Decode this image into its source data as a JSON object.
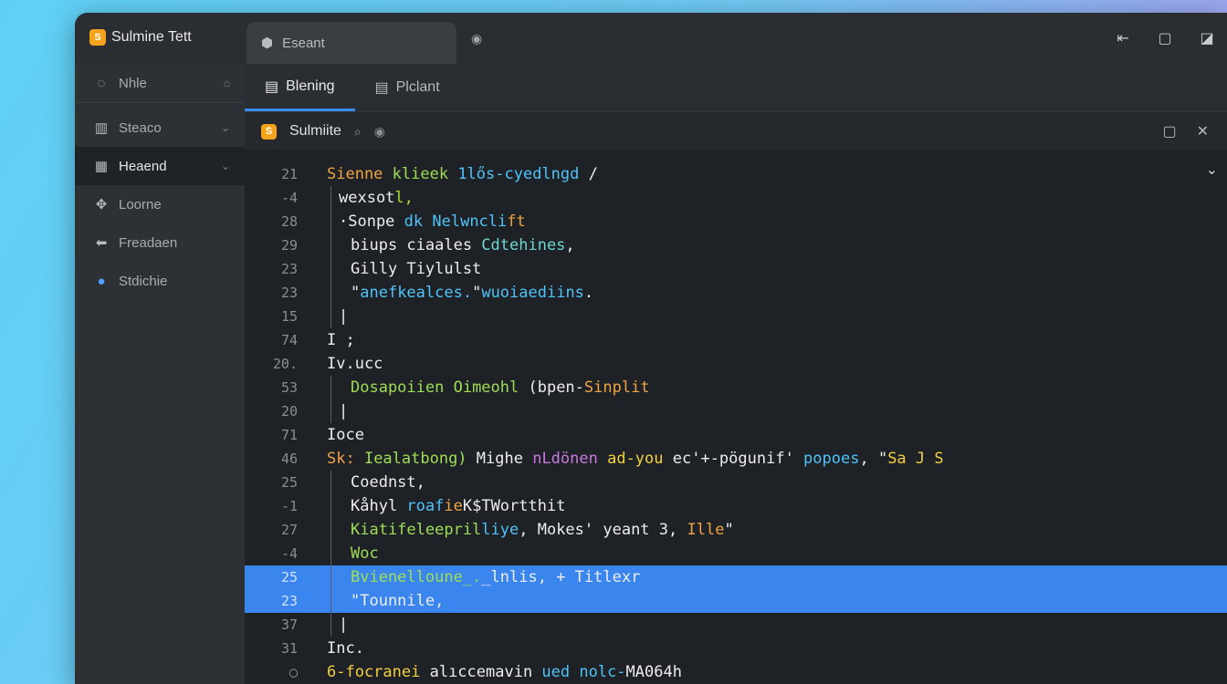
{
  "window": {
    "app_title": "Sulmine Tett",
    "tab_label": "Eseant",
    "controls": [
      "⇤",
      "▢",
      "◪"
    ]
  },
  "sidebar": {
    "items": [
      {
        "label": "Nhle",
        "icon": "wifi-icon",
        "glyph": "◌",
        "extra": "⌂"
      },
      {
        "label": "Steaco",
        "icon": "grid-icon",
        "glyph": "▥",
        "extra": "⌄"
      },
      {
        "label": "Heaend",
        "icon": "bar-chart-icon",
        "glyph": "▦",
        "extra": "⌄"
      },
      {
        "label": "Loorne",
        "icon": "pin-icon",
        "glyph": "✥",
        "extra": ""
      },
      {
        "label": "Freadaen",
        "icon": "back-arrow-icon",
        "glyph": "⬅",
        "extra": ""
      },
      {
        "label": "Stdichie",
        "icon": "globe-icon",
        "glyph": "●",
        "extra": ""
      }
    ]
  },
  "tabs": [
    {
      "label": "Blening",
      "icon": "doc-icon",
      "glyph": "▤"
    },
    {
      "label": "Plclant",
      "icon": "list-icon",
      "glyph": "▤"
    }
  ],
  "filebar": {
    "filename": "Sulmiite",
    "search_glyph": "⌕",
    "zoom_glyph": "◉",
    "right_controls": [
      "▢",
      "✕"
    ]
  },
  "editor": {
    "lines": [
      {
        "n": "21",
        "indent": 0,
        "parts": [
          [
            "Sienne ",
            "c-orange"
          ],
          [
            "klieek ",
            "c-lime"
          ],
          [
            "1lős-cyedlngd ",
            "c-cyan"
          ],
          [
            "/",
            "c-white"
          ]
        ]
      },
      {
        "n": "-4",
        "indent": 1,
        "parts": [
          [
            "wexsot",
            "c-white"
          ],
          [
            "l,",
            "c-green"
          ]
        ]
      },
      {
        "n": "28",
        "indent": 1,
        "parts": [
          [
            "·Sonpe ",
            "c-white"
          ],
          [
            "dk ",
            "c-cyan"
          ],
          [
            "Nelwncli",
            "c-cyan"
          ],
          [
            "ft",
            "c-orange"
          ]
        ]
      },
      {
        "n": "29",
        "indent": 2,
        "parts": [
          [
            "biups ciaales ",
            "c-white"
          ],
          [
            "Cdtehines",
            "c-teal"
          ],
          [
            ",",
            "c-white"
          ]
        ]
      },
      {
        "n": "23",
        "indent": 2,
        "parts": [
          [
            "Gilly Tiylulst",
            "c-white"
          ]
        ]
      },
      {
        "n": "23",
        "indent": 2,
        "parts": [
          [
            "\"",
            "c-white"
          ],
          [
            "anefkealces.",
            "c-cyan"
          ],
          [
            "\"",
            "c-white"
          ],
          [
            "wuoiaediins",
            "c-cyan"
          ],
          [
            ".",
            "c-white"
          ]
        ]
      },
      {
        "n": "15",
        "indent": 1,
        "parts": [
          [
            "|",
            "c-white"
          ]
        ]
      },
      {
        "n": "74",
        "indent": 0,
        "parts": [
          [
            "I ;",
            "c-white"
          ]
        ]
      },
      {
        "n": "20.",
        "indent": 0,
        "parts": [
          [
            "Iv.ucc",
            "c-white"
          ]
        ]
      },
      {
        "n": "53",
        "indent": 2,
        "parts": [
          [
            "Dosapoiien ",
            "c-lime"
          ],
          [
            "Oimeohl ",
            "c-lime"
          ],
          [
            "(bpen-",
            "c-white"
          ],
          [
            "Sinplit",
            "c-orange"
          ]
        ]
      },
      {
        "n": "20",
        "indent": 1,
        "parts": [
          [
            "|",
            "c-white"
          ]
        ]
      },
      {
        "n": "71",
        "indent": 0,
        "parts": [
          [
            "Ioce",
            "c-white"
          ]
        ]
      },
      {
        "n": "46",
        "indent": 0,
        "parts": [
          [
            "Sk: ",
            "c-orange"
          ],
          [
            "Iealatbong) ",
            "c-lime"
          ],
          [
            "Mighe ",
            "c-white"
          ],
          [
            "nLdönen ",
            "c-purple"
          ],
          [
            "ad-you ",
            "c-yellow"
          ],
          [
            "ec'+-pögunif' ",
            "c-white"
          ],
          [
            "popoes",
            "c-cyan"
          ],
          [
            ", \"",
            "c-white"
          ],
          [
            "Sa J S",
            "c-yellow"
          ]
        ]
      },
      {
        "n": "25",
        "indent": 2,
        "parts": [
          [
            "Coednst,",
            "c-white"
          ]
        ]
      },
      {
        "n": "-1",
        "indent": 2,
        "parts": [
          [
            "Kåhyl ",
            "c-white"
          ],
          [
            "roaf",
            "c-cyan"
          ],
          [
            "ie",
            "c-orange"
          ],
          [
            "K$TWortthit",
            "c-white"
          ]
        ]
      },
      {
        "n": "27",
        "indent": 2,
        "parts": [
          [
            "Kiatifeleepril",
            "c-lime"
          ],
          [
            "liye",
            "c-cyan"
          ],
          [
            ", Mokes' yeant 3, ",
            "c-white"
          ],
          [
            "Ille",
            "c-orange"
          ],
          [
            "\"",
            "c-white"
          ]
        ]
      },
      {
        "n": "-4",
        "indent": 2,
        "parts": [
          [
            "Woc",
            "c-lime"
          ]
        ]
      },
      {
        "n": "25",
        "indent": 2,
        "sel": true,
        "parts": [
          [
            "Bvienelloune_.",
            "c-lime"
          ],
          [
            "_",
            "c-white"
          ],
          [
            "lnlis, + Titlexr",
            "c-white"
          ]
        ]
      },
      {
        "n": "23",
        "indent": 2,
        "sel": true,
        "parts": [
          [
            "\"Tounnile,",
            "c-white"
          ]
        ]
      },
      {
        "n": "37",
        "indent": 1,
        "parts": [
          [
            "|",
            "c-white"
          ]
        ]
      },
      {
        "n": "31",
        "indent": 0,
        "parts": [
          [
            "Inc.",
            "c-white"
          ]
        ]
      },
      {
        "n": "◯",
        "indent": 0,
        "parts": [
          [
            "6-focranei ",
            "c-yellow"
          ],
          [
            "alıccemavin ",
            "c-white"
          ],
          [
            "ued nolc-",
            "c-cyan"
          ],
          [
            "MA064h",
            "c-white"
          ]
        ]
      }
    ]
  }
}
